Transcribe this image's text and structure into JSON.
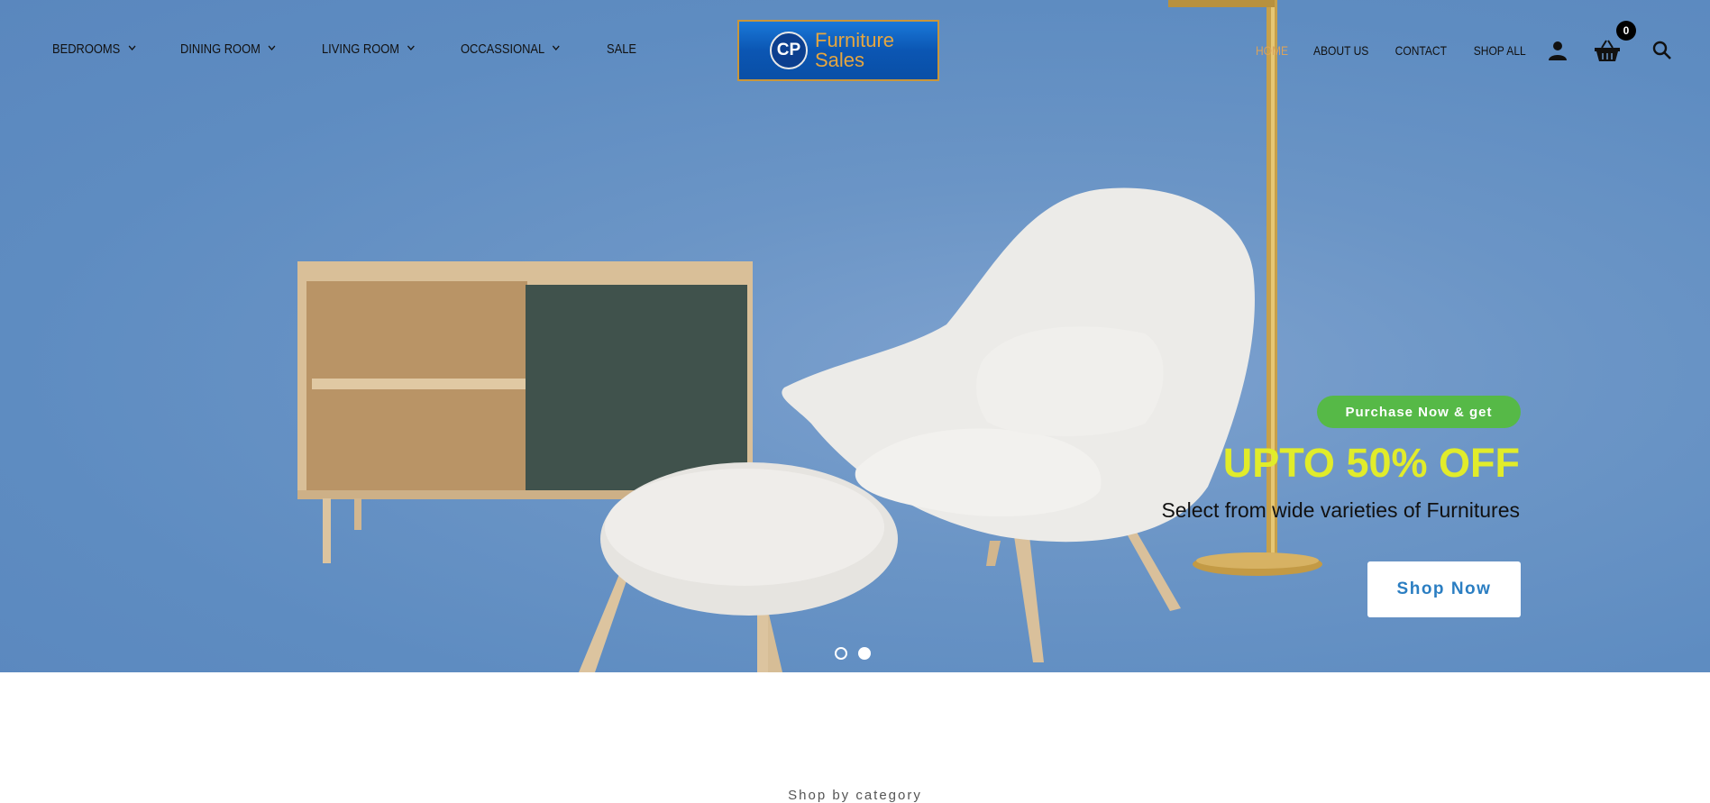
{
  "nav": {
    "left": [
      {
        "label": "BEDROOMS",
        "has_dropdown": true
      },
      {
        "label": "DINING ROOM",
        "has_dropdown": true
      },
      {
        "label": "LIVING ROOM",
        "has_dropdown": true
      },
      {
        "label": "OCCASSIONAL",
        "has_dropdown": true
      },
      {
        "label": "SALE",
        "has_dropdown": false
      }
    ],
    "right": [
      {
        "label": "HOME",
        "active": true
      },
      {
        "label": "ABOUT US",
        "active": false
      },
      {
        "label": "CONTACT",
        "active": false
      },
      {
        "label": "SHOP ALL",
        "active": false
      }
    ],
    "cart_count": "0",
    "icons": [
      "user-icon",
      "basket-icon",
      "search-icon"
    ]
  },
  "logo": {
    "initials": "CP",
    "line1": "Furniture",
    "line2": "Sales"
  },
  "hero": {
    "pill": "Purchase Now & get",
    "headline": "UPTO 50% OFF",
    "subtext": "Select from wide varieties of Furnitures",
    "cta": "Shop Now",
    "slide_count": 2,
    "active_slide": 2
  },
  "section": {
    "title": "Shop by category"
  },
  "colors": {
    "hero_bg": "#6b95c6",
    "active_nav": "#d9a35c",
    "pill_green": "#56b947",
    "headline_yellow": "#e1ec2a",
    "cta_text": "#2b7ec2"
  }
}
